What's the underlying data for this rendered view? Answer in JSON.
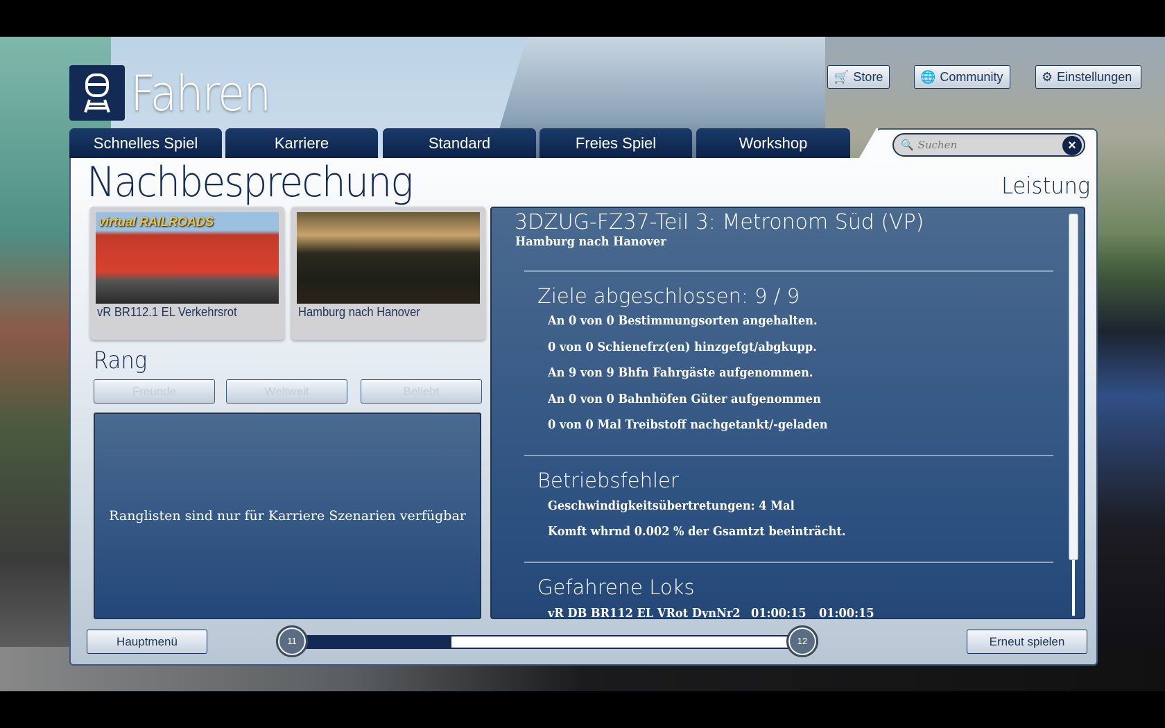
{
  "app": {
    "title": "Fahren"
  },
  "top_buttons": [
    {
      "label": "Store",
      "icon": "cart-icon"
    },
    {
      "label": "Community",
      "icon": "globe-icon"
    },
    {
      "label": "Einstellungen",
      "icon": "gear-icon"
    }
  ],
  "tabs": [
    "Schnelles Spiel",
    "Karriere",
    "Standard",
    "Freies Spiel",
    "Workshop"
  ],
  "search": {
    "placeholder": "Suchen",
    "value": ""
  },
  "page": {
    "title": "Nachbesprechung",
    "section": "Leistung"
  },
  "cards": [
    {
      "caption": "vR BR112.1 EL Verkehrsrot",
      "logo_text": "virtual RAILROADS"
    },
    {
      "caption": "Hamburg nach Hanover"
    }
  ],
  "rank": {
    "title": "Rang",
    "buttons": [
      "Freunde",
      "Weltweit",
      "Beliebt"
    ],
    "message": "Ranglisten sind nur für Karriere Szenarien verfügbar"
  },
  "details": {
    "title": "3DZUG-FZ37-Teil 3: Metronom Süd (VP)",
    "subtitle": "Hamburg nach Hanover",
    "goals_heading": "Ziele abgeschlossen: 9 / 9",
    "goals": [
      "An 0 von 0 Bestimmungsorten angehalten.",
      "0 von 0 Schienefrz(en) hinzgefgt/abgkupp.",
      "An 9 von 9 Bhfn Fahrgäste aufgenommen.",
      "An 0 von 0 Bahnhöfen Güter aufgenommen",
      "0 von 0 Mal Treibstoff nachgetankt/-geladen"
    ],
    "errors_heading": "Betriebsfehler",
    "errors": [
      "Geschwindigkeitsübertretungen: 4 Mal",
      "Komft whrnd 0.002 % der Gsamtzt beeinträcht."
    ],
    "locos_heading": "Gefahrene Loks",
    "locos": [
      {
        "name": "vR DB BR112 EL VRot DynNr2",
        "time1": "01:00:15",
        "time2": "01:00:15"
      }
    ]
  },
  "bottom": {
    "main_menu": "Hauptmenü",
    "replay": "Erneut spielen",
    "level_from": "11",
    "level_to": "12",
    "progress_fraction": 0.3
  },
  "colors": {
    "navy": "#132a55",
    "panel_blue": "#2b4f7f"
  }
}
